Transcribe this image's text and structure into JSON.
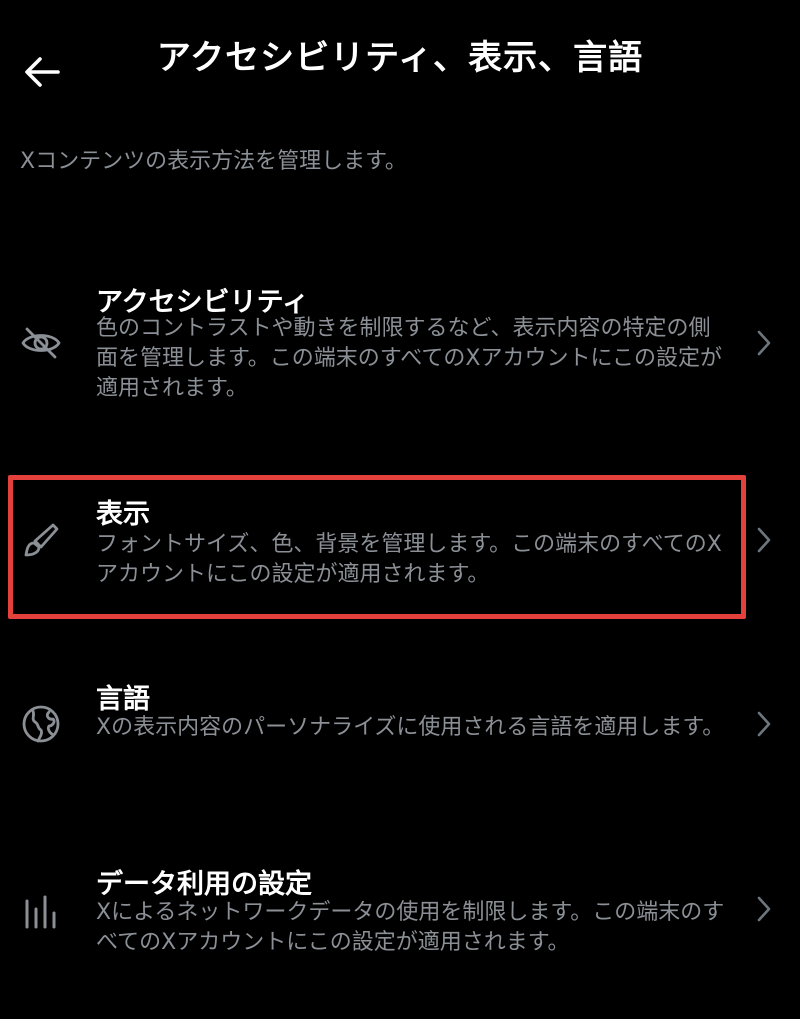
{
  "header": {
    "title": "アクセシビリティ、表示、言語",
    "back_icon": "arrow-left-icon"
  },
  "description": "Xコンテンツの表示方法を管理します。",
  "items": [
    {
      "title": "アクセシビリティ",
      "description": "色のコントラストや動きを制限するなど、表示内容の特定の側面を管理します。この端末のすべてのXアカウントにこの設定が適用されます。",
      "icon": "eye-slash-icon"
    },
    {
      "title": "表示",
      "description": "フォントサイズ、色、背景を管理します。この端末のすべてのXアカウントにこの設定が適用されます。",
      "icon": "brush-icon"
    },
    {
      "title": "言語",
      "description": "Xの表示内容のパーソナライズに使用される言語を適用します。",
      "icon": "globe-icon"
    },
    {
      "title": "データ利用の設定",
      "description": "Xによるネットワークデータの使用を制限します。この端末のすべてのXアカウントにこの設定が適用されます。",
      "icon": "bar-chart-icon"
    }
  ],
  "colors": {
    "background": "#000000",
    "title_text": "#ffffff",
    "secondary_text": "#8b9096",
    "highlight": "#e5413c"
  }
}
